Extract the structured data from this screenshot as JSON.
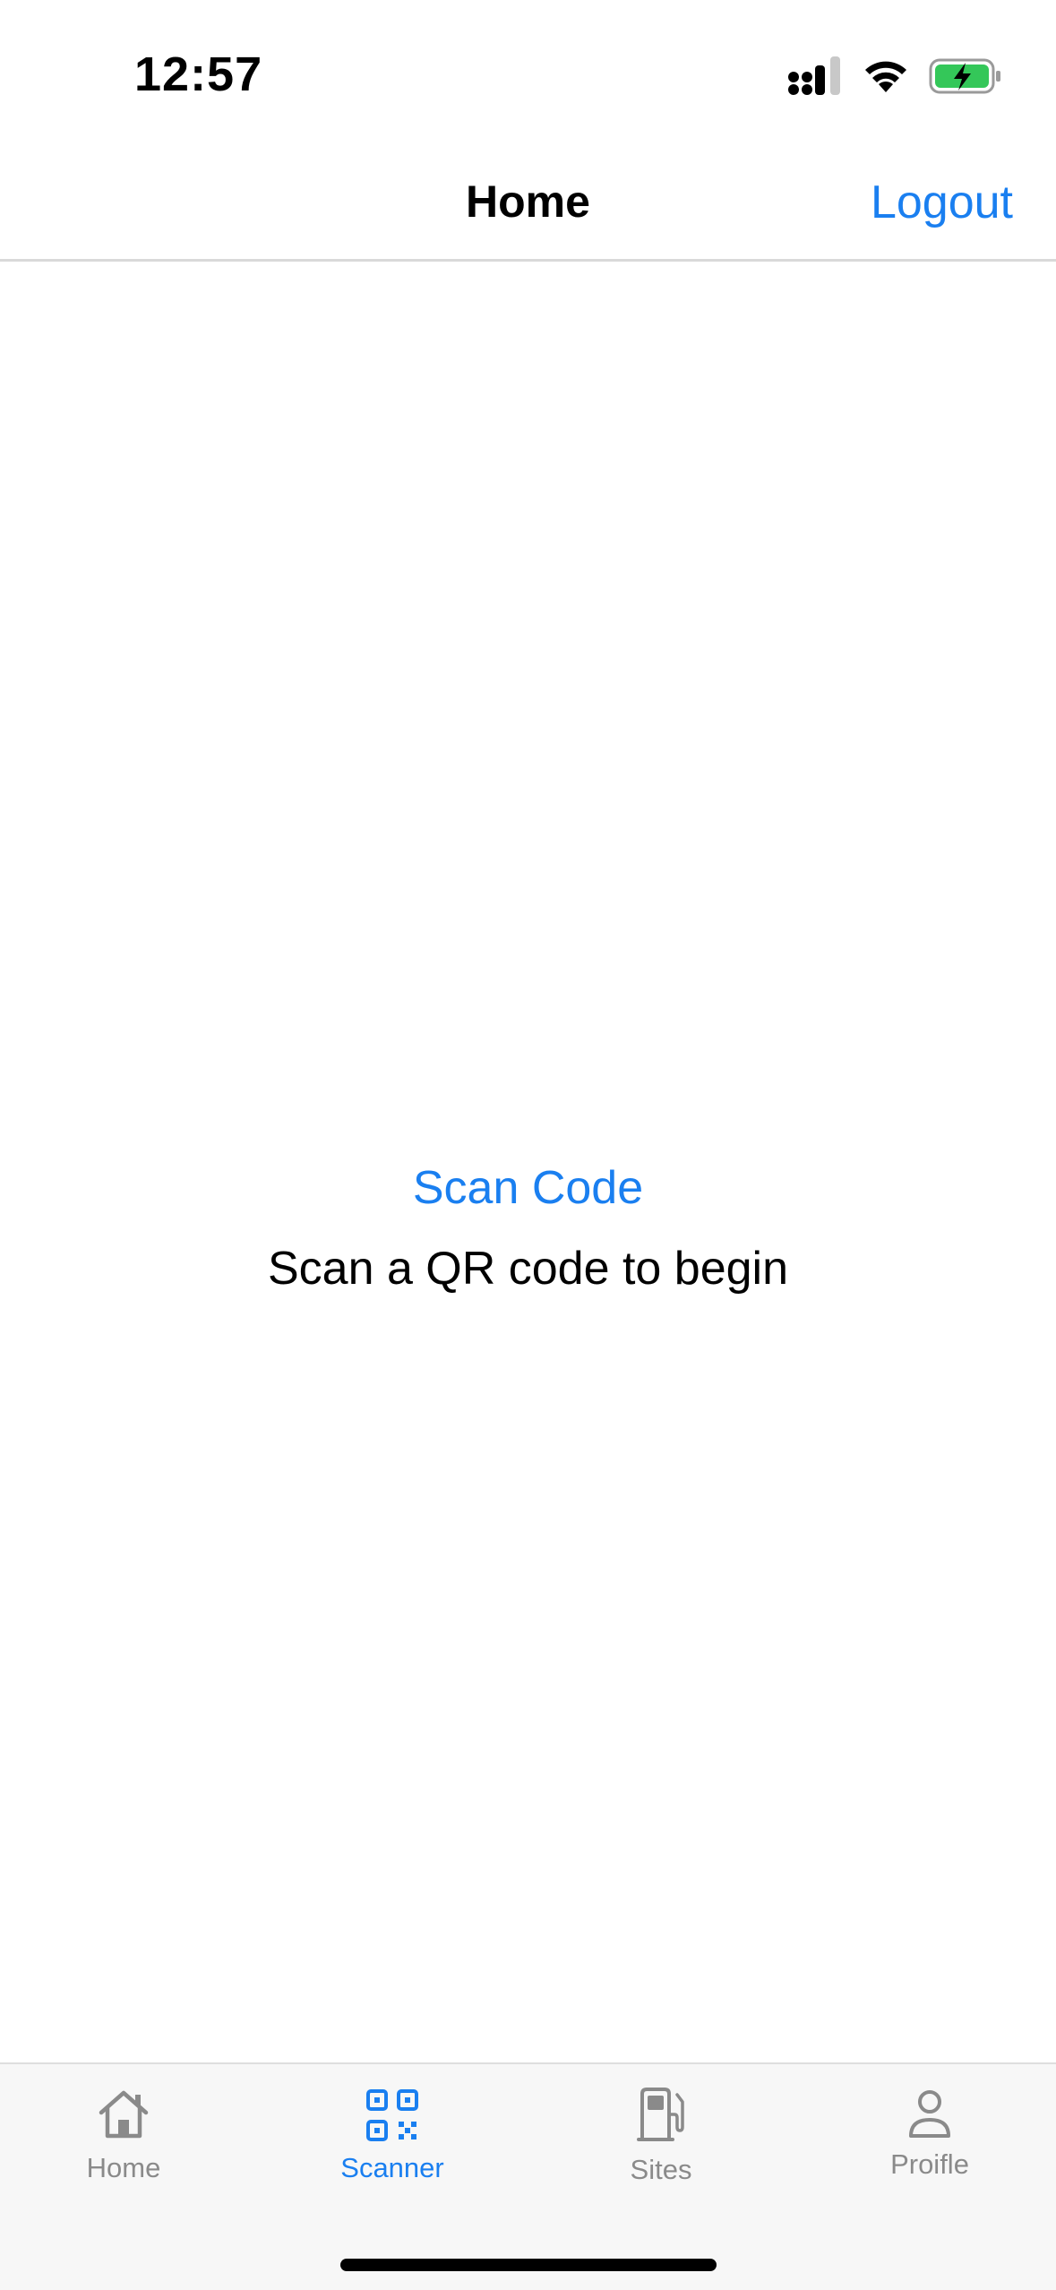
{
  "status_bar": {
    "time": "12:57"
  },
  "header": {
    "title": "Home",
    "logout_label": "Logout"
  },
  "main": {
    "scan_button_label": "Scan Code",
    "hint_text": "Scan a QR code to begin"
  },
  "tabs": [
    {
      "label": "Home",
      "icon": "home-icon",
      "active": false
    },
    {
      "label": "Scanner",
      "icon": "qr-code-icon",
      "active": true
    },
    {
      "label": "Sites",
      "icon": "fuel-pump-icon",
      "active": false
    },
    {
      "label": "Proifle",
      "icon": "person-icon",
      "active": false
    }
  ],
  "colors": {
    "accent": "#1a7ff0",
    "inactive_tab": "#8a8a8a",
    "battery_fill": "#34c759",
    "tab_bar_bg": "#f7f7f7"
  }
}
